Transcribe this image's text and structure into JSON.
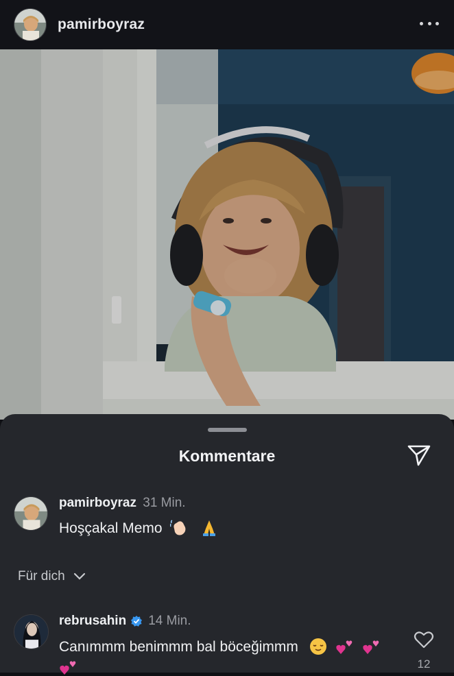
{
  "header": {
    "username": "pamirboyraz",
    "more_icon": "more-horizontal-icon"
  },
  "post": {
    "image_description_icon": "photo"
  },
  "comments_sheet": {
    "title": "Kommentare",
    "send_icon": "send-icon",
    "pinned_comment": {
      "username": "pamirboyraz",
      "time": "31 Min.",
      "text": "Hoşçakal Memo",
      "emojis": [
        "waving-hand",
        "folded-hands"
      ]
    },
    "filter": {
      "label": "Für dich"
    },
    "comments": [
      {
        "username": "rebrusahin",
        "verified": true,
        "time": "14 Min.",
        "text": "Canımmm benimmm bal böceğimmm",
        "emojis": [
          "relieved-face",
          "two-hearts",
          "two-hearts",
          "two-hearts"
        ],
        "likes": "12"
      }
    ]
  },
  "colors": {
    "background": "#0f1014",
    "sheet": "#25272c",
    "verified_blue": "#3897f0",
    "muted_text": "#9a9ca2",
    "heart_pink": "#e0348f"
  }
}
